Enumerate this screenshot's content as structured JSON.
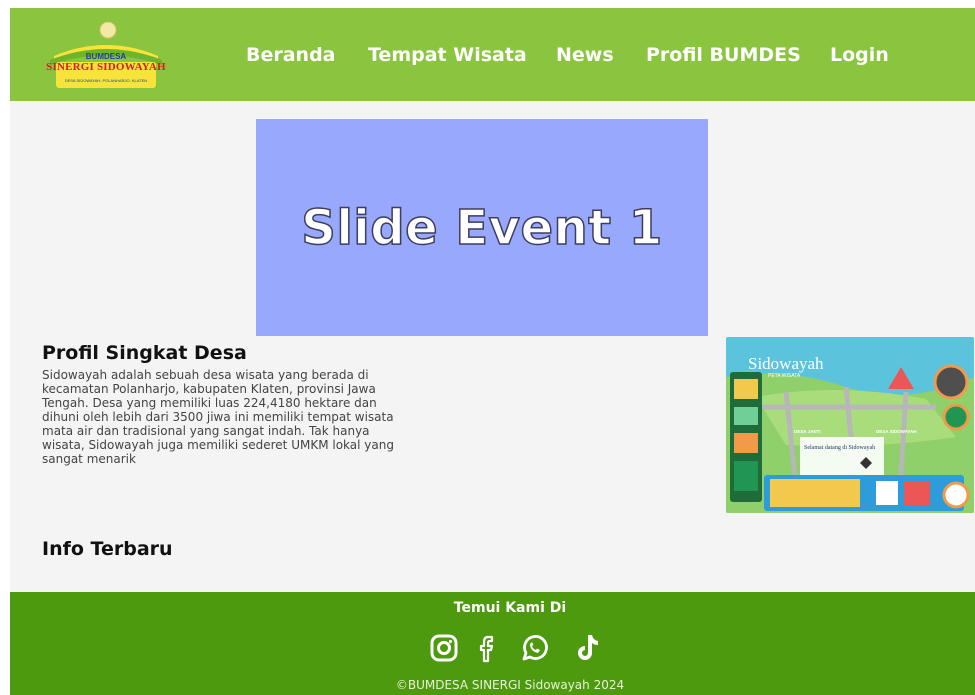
{
  "header": {
    "logo": {
      "line1": "BUMDESA",
      "line2": "SINERGI SIDOWAYAH",
      "line3": "DESA SIDOWAYAH, POLANHARJO, KLATEN"
    },
    "nav": [
      {
        "label": "Beranda"
      },
      {
        "label": "Tempat Wisata"
      },
      {
        "label": "News"
      },
      {
        "label": "Profil BUMDES"
      },
      {
        "label": "Login"
      }
    ]
  },
  "slider": {
    "title": "Slide Event 1",
    "background": "#98a8fc"
  },
  "profil": {
    "title": "Profil Singkat Desa",
    "text": "Sidowayah adalah sebuah desa wisata yang berada di kecamatan Polanharjo, kabupaten Klaten, provinsi Jawa Tengah. Desa yang memiliki luas 224,4180 hektare dan dihuni oleh lebih dari 3500 jiwa ini memiliki tempat wisata mata air dan tradisional yang sangat indah. Tak hanya wisata, Sidowayah juga memiliki sederet UMKM lokal yang sangat menarik"
  },
  "map": {
    "title": "Sidowayah",
    "subtitle": "PETA WISATA",
    "label_a": "DESA JANTI",
    "label_b": "DESA SIDOWAYAH",
    "welcome": "Selamat datang di Sidowayah"
  },
  "info": {
    "title": "Info Terbaru"
  },
  "footer": {
    "title": "Temui Kami Di",
    "socials": [
      {
        "icon": "instagram-icon"
      },
      {
        "icon": "facebook-icon"
      },
      {
        "icon": "whatsapp-icon"
      },
      {
        "icon": "tiktok-icon"
      }
    ],
    "copyright": "©BUMDESA SINERGI Sidowayah 2024"
  },
  "colors": {
    "header_bg": "#8bc53f",
    "footer_bg": "#4e9a0e",
    "page_bg": "#f4f4f4"
  }
}
